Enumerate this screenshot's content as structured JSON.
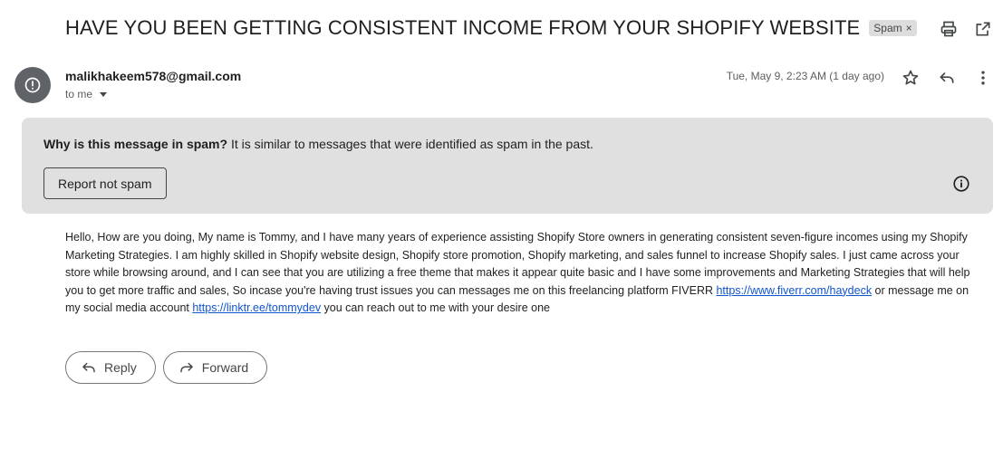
{
  "email": {
    "subject": "HAVE YOU BEEN GETTING CONSISTENT INCOME FROM YOUR SHOPIFY WEBSITE",
    "label_chip": "Spam",
    "label_chip_remove": "×",
    "sender": "malikhakeem578@gmail.com",
    "recipient_summary": "to me",
    "date": "Tue, May 9, 2:23 AM (1 day ago)"
  },
  "spam_notice": {
    "question": "Why is this message in spam?",
    "explanation": " It is similar to messages that were identified as spam in the past.",
    "report_button": "Report not spam"
  },
  "body": {
    "text_1": "Hello, How are you doing, My name is Tommy, and I have many years of experience assisting Shopify Store owners in generating consistent seven-figure incomes using my Shopify Marketing Strategies. I am highly skilled in Shopify website design, Shopify store promotion, Shopify marketing, and sales funnel to increase Shopify sales. I just came across your store while browsing around, and I can see that you are utilizing a free theme that makes it appear quite basic and I have some improvements and Marketing Strategies that will help you to get more traffic and sales, So incase you're having trust issues you can messages me on this freelancing platform FIVERR ",
    "link_1": "https://www.fiverr.com/haydeck",
    "text_2": " or message me on my social media account ",
    "link_2": "https://linktr.ee/tommydev",
    "text_3": " you can reach out to me with your desire one"
  },
  "actions": {
    "reply": "Reply",
    "forward": "Forward"
  },
  "icons": {
    "print": "print-icon",
    "open_new_window": "open-in-new-icon",
    "avatar": "spam-warning-icon",
    "star": "star-icon",
    "reply": "reply-icon",
    "more": "more-vert-icon",
    "info": "info-icon",
    "forward": "forward-icon"
  },
  "colors": {
    "spam_banner_bg": "#e0e0e0",
    "avatar_bg": "#5f6368",
    "link": "#1155cc"
  }
}
